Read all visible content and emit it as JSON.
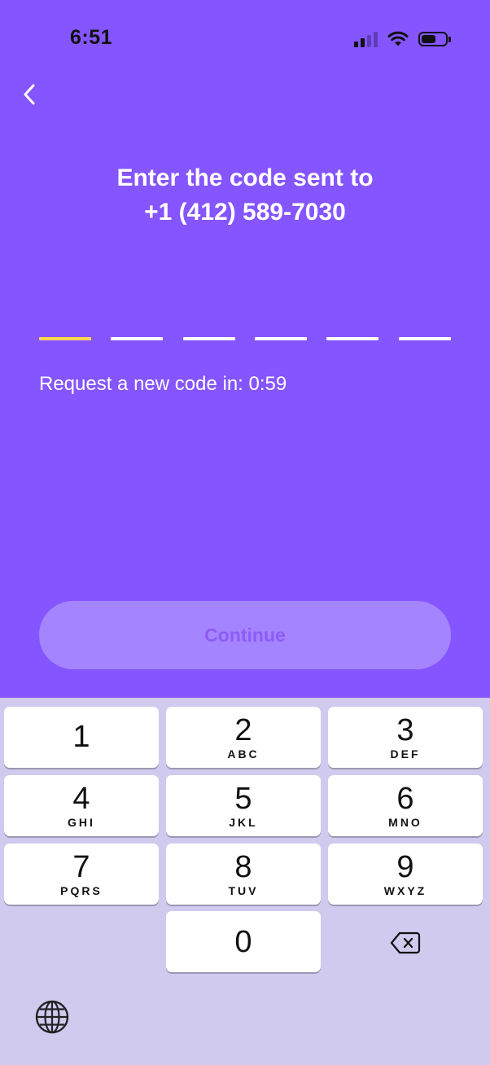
{
  "status_bar": {
    "time": "6:51"
  },
  "header": {
    "title_line1": "Enter the code sent to",
    "title_line2": "+1 (412) 589-7030"
  },
  "code_input": {
    "slots": 6,
    "filled": 0
  },
  "resend": {
    "text": "Request a new code in: 0:59"
  },
  "continue_button": {
    "label": "Continue",
    "enabled": false
  },
  "keypad": {
    "keys": [
      {
        "num": "1",
        "letters": ""
      },
      {
        "num": "2",
        "letters": "ABC"
      },
      {
        "num": "3",
        "letters": "DEF"
      },
      {
        "num": "4",
        "letters": "GHI"
      },
      {
        "num": "5",
        "letters": "JKL"
      },
      {
        "num": "6",
        "letters": "MNO"
      },
      {
        "num": "7",
        "letters": "PQRS"
      },
      {
        "num": "8",
        "letters": "TUV"
      },
      {
        "num": "9",
        "letters": "WXYZ"
      },
      {
        "num": "0",
        "letters": ""
      }
    ],
    "icons": {
      "delete": "backspace-icon",
      "globe": "globe-icon"
    }
  },
  "colors": {
    "background": "#8555FF",
    "active_slot": "#FFD556",
    "button": "#A584FF",
    "keyboard": "#D0CAEE"
  }
}
